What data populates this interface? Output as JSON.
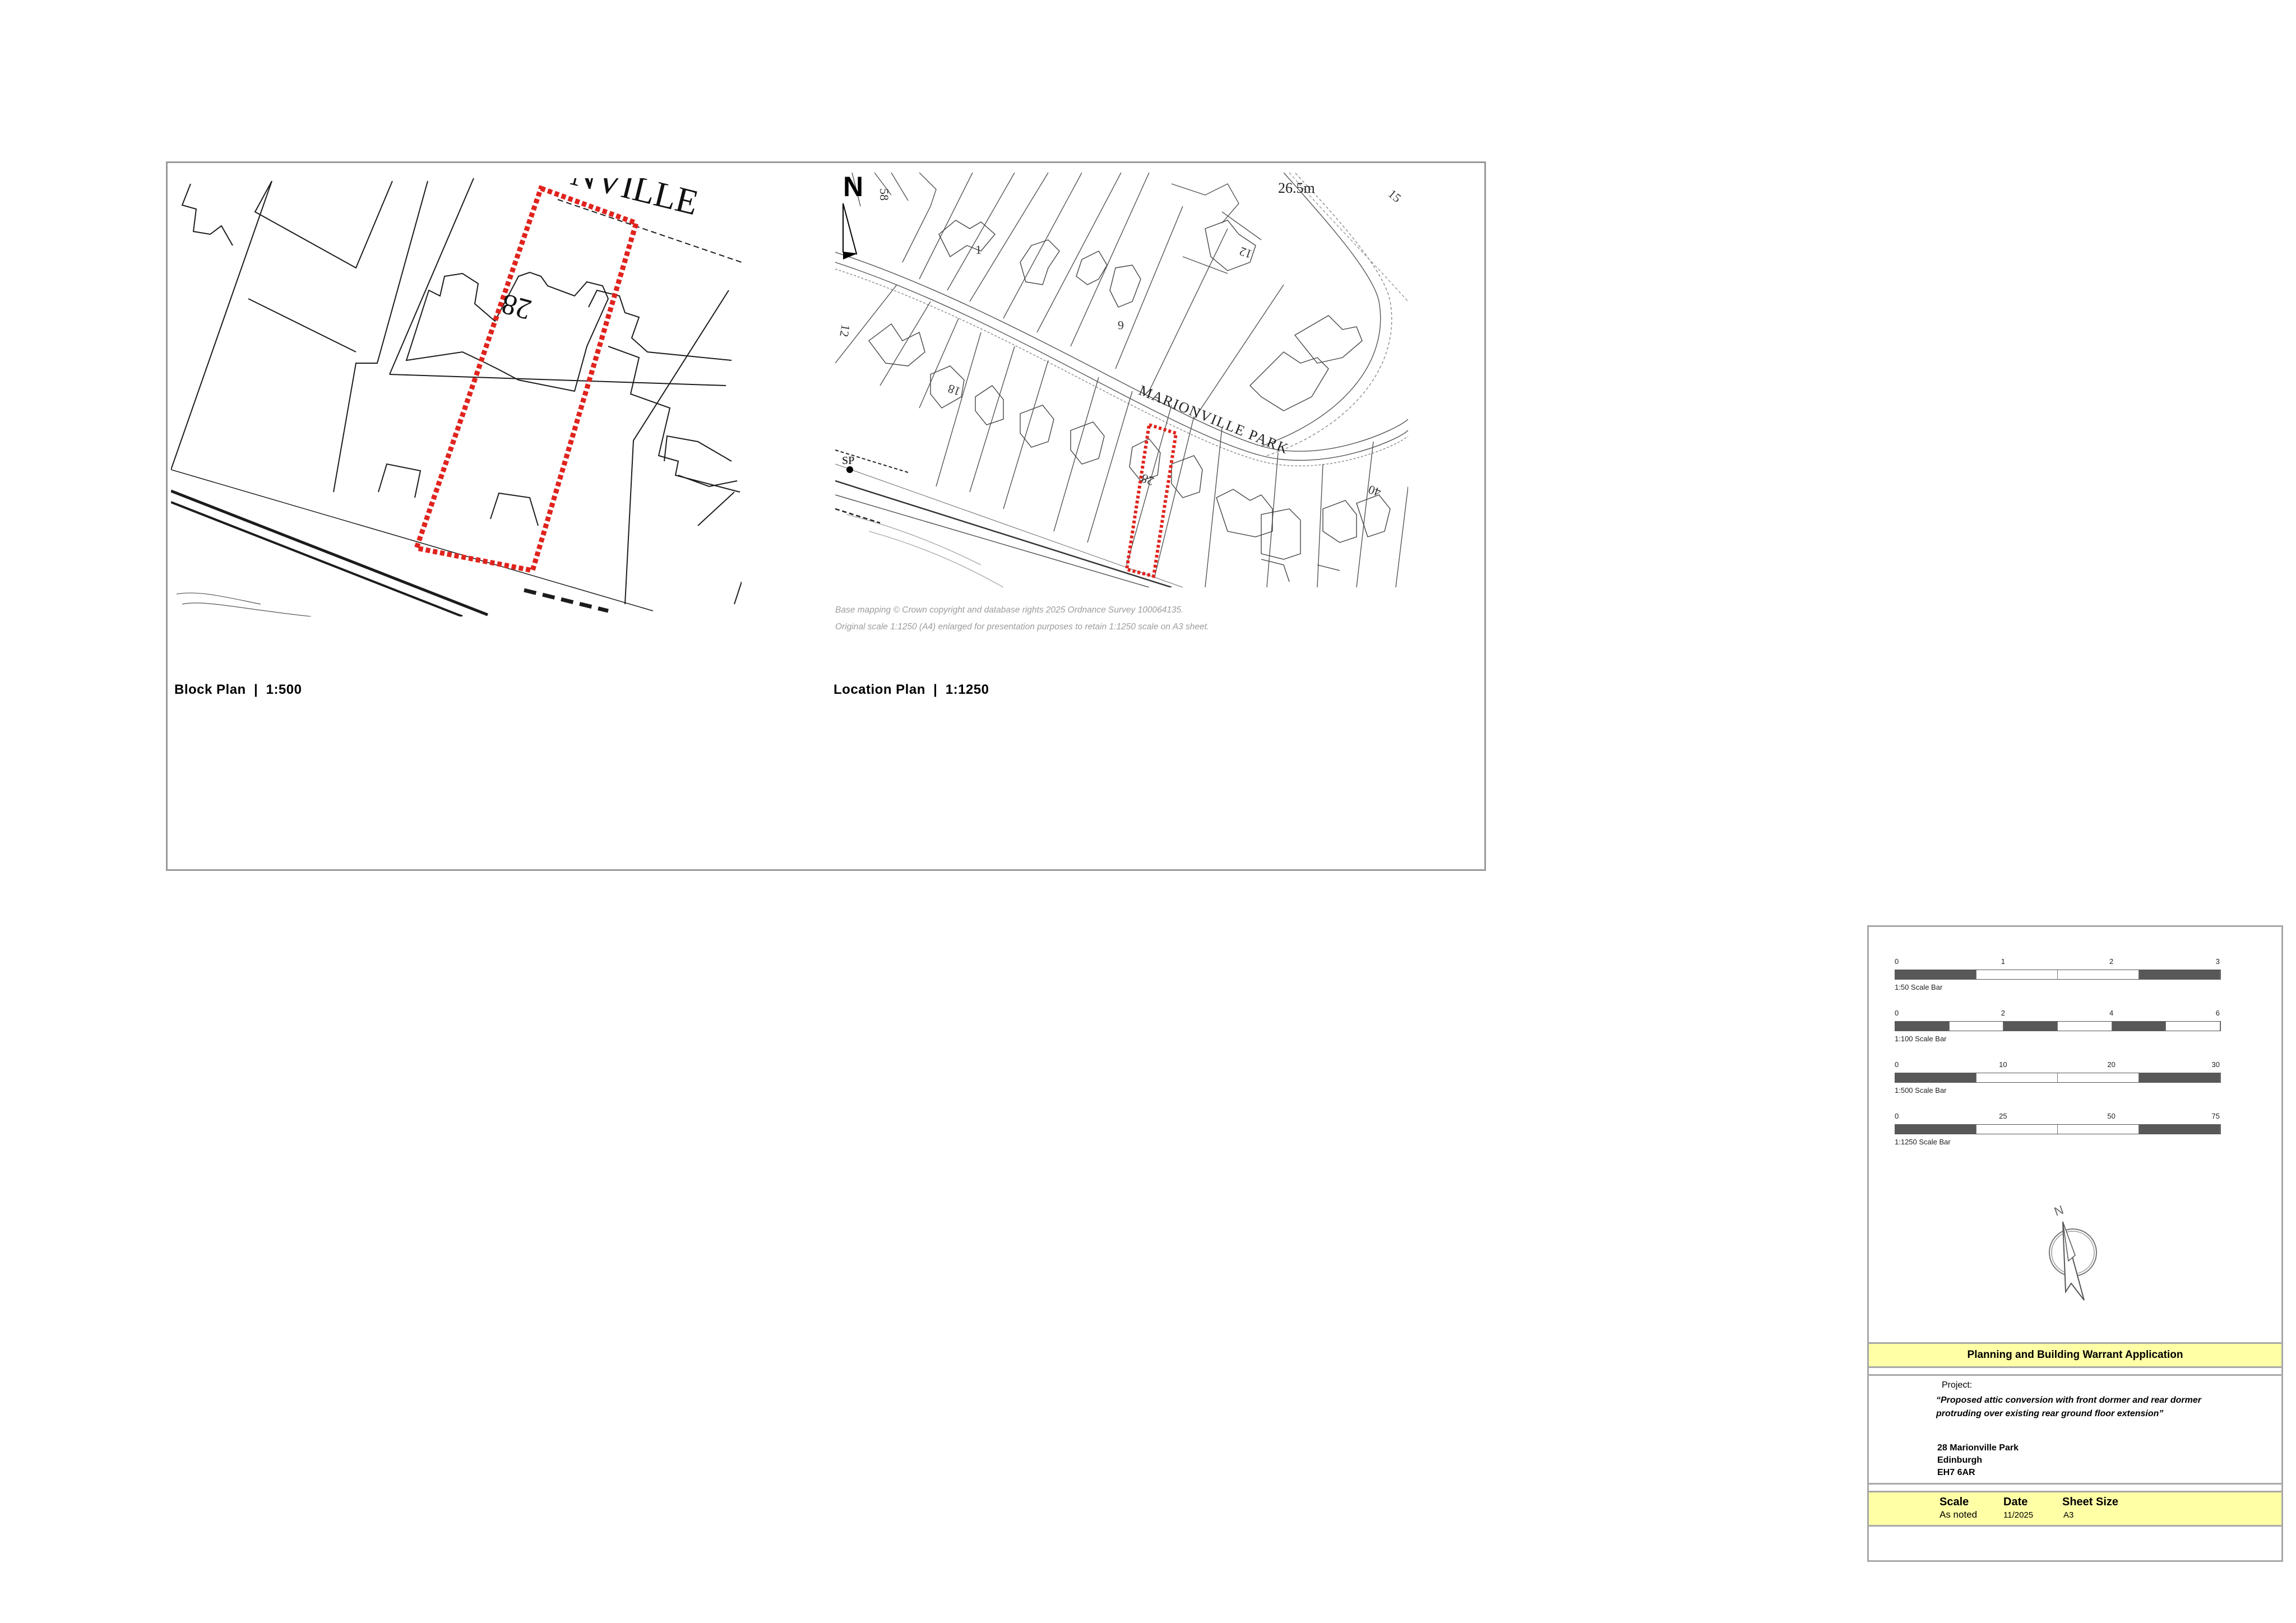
{
  "block_plan": {
    "title": "Block Plan  |  1:500",
    "street_label": "NVILLE",
    "plot_number": "28"
  },
  "location_plan": {
    "title": "Location Plan  |  1:1250",
    "north_letter": "N",
    "street_label": "MARIONVILLE PARK",
    "spot_height": "26.5m",
    "marker_label": "SP",
    "house_numbers": [
      "58",
      "1",
      "12",
      "6",
      "12",
      "18",
      "28",
      "15",
      "40"
    ],
    "copyright_line1": "Base mapping © Crown copyright and database rights 2025 Ordnance Survey 100064135.",
    "copyright_line2": "Original scale 1:1250 (A4) enlarged for presentation purposes to retain 1:1250 scale on A3 sheet."
  },
  "scale_bars": [
    {
      "caption": "1:50 Scale Bar",
      "ticks": [
        "0",
        "1",
        "2",
        "3"
      ],
      "pattern": [
        "dark",
        "light",
        "light",
        "dark"
      ]
    },
    {
      "caption": "1:100 Scale Bar",
      "ticks": [
        "0",
        "2",
        "4",
        "6"
      ],
      "pattern": [
        "dark",
        "light",
        "dark",
        "light",
        "dark",
        "light"
      ]
    },
    {
      "caption": "1:500 Scale Bar",
      "ticks": [
        "0",
        "10",
        "20",
        "30"
      ],
      "pattern": [
        "dark",
        "light",
        "light",
        "dark"
      ]
    },
    {
      "caption": "1:1250 Scale Bar",
      "ticks": [
        "0",
        "25",
        "50",
        "75"
      ],
      "pattern": [
        "dark",
        "light",
        "light",
        "dark"
      ]
    }
  ],
  "title_block": {
    "heading": "Planning and Building Warrant Application",
    "project_label": "Project:",
    "project_description": "“Proposed attic conversion with front dormer and rear dormer protruding over existing rear ground floor extension”",
    "address": [
      "28 Marionville Park",
      "Edinburgh",
      "EH7 6AR"
    ],
    "scale_label": "Scale",
    "scale_value": "As noted",
    "date_label": "Date",
    "date_value": "11/2025",
    "sheet_label": "Sheet Size",
    "sheet_value": "A3",
    "north_symbol_letter": "N"
  },
  "colors": {
    "boundary_red": "#e0231d",
    "frame_gray": "#9a9a9a",
    "title_yellow": "#ffffa6",
    "scale_dark": "#585858"
  }
}
